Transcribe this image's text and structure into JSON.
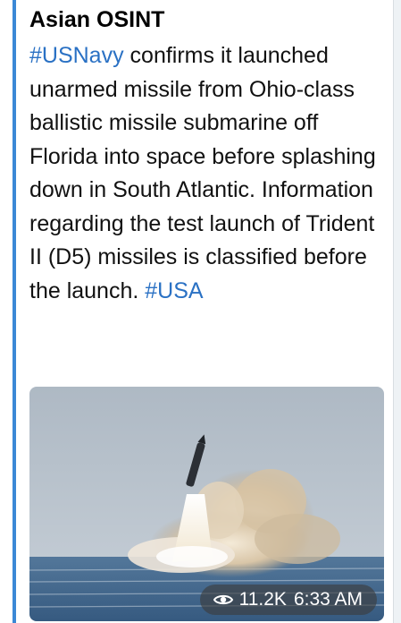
{
  "post": {
    "channel": "Asian OSINT",
    "segments": [
      {
        "text": "#USNavy",
        "hashtag": true
      },
      {
        "text": " confirms it launched unarmed missile from Ohio-class ballistic missile submarine off Florida into space before splashing down in South Atlantic. Information regarding the test launch of Trident II (D5) missiles is classified before the launch. ",
        "hashtag": false
      },
      {
        "text": "#USA",
        "hashtag": true
      }
    ],
    "views": "11.2K",
    "time": "6:33 AM"
  },
  "colors": {
    "accent": "#3b88d6",
    "hashtag": "#2a71c4"
  },
  "icons": {
    "views": "eye-icon"
  }
}
